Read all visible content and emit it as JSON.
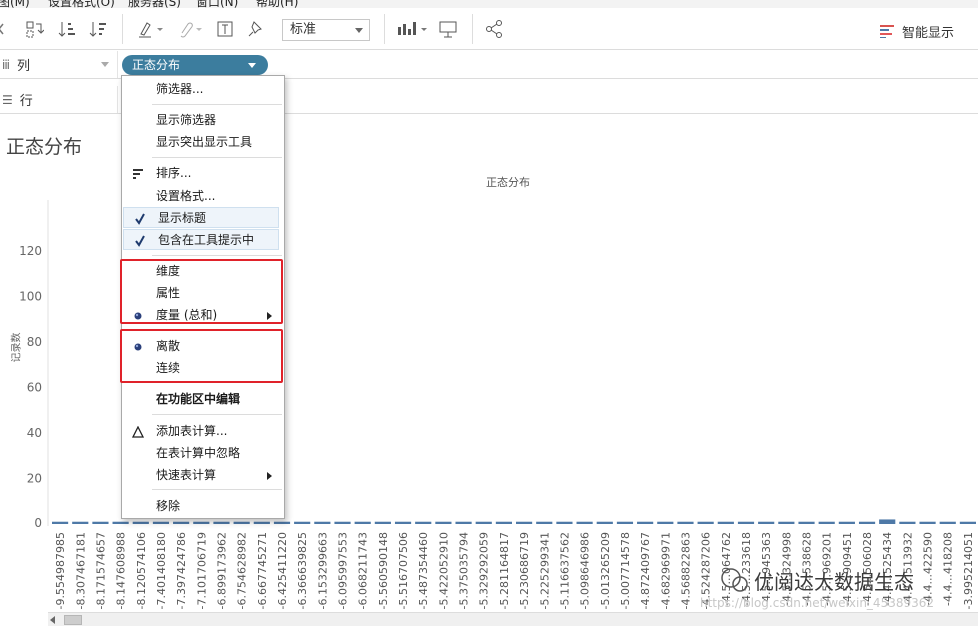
{
  "menubar": [
    "图(M)",
    "设置格式(O)",
    "服务器(S)",
    "窗口(N)",
    "帮助(H)"
  ],
  "toolbar": {
    "mark_size_select": "标准",
    "smart_display": "智能显示"
  },
  "shelves": {
    "columns_label": "列",
    "rows_label": "行",
    "pill_label": "正态分布"
  },
  "view": {
    "title": "正态分布",
    "header": "正态分布",
    "y_axis_title": "记录数"
  },
  "context_menu": {
    "items": [
      {
        "label": "筛选器..."
      },
      {
        "label": "显示筛选器"
      },
      {
        "label": "显示突出显示工具"
      },
      {
        "label": "排序...",
        "icon": "sort-icon"
      },
      {
        "label": "设置格式..."
      },
      {
        "label": "显示标题",
        "checked": true
      },
      {
        "label": "包含在工具提示中",
        "checked": true
      },
      {
        "label": "维度"
      },
      {
        "label": "属性"
      },
      {
        "label": "度量 (总和)",
        "selected": true,
        "submenu": true
      },
      {
        "label": "离散",
        "selected": true
      },
      {
        "label": "连续"
      },
      {
        "label": "在功能区中编辑",
        "bold": true
      },
      {
        "label": "添加表计算...",
        "icon": "delta-icon"
      },
      {
        "label": "在表计算中忽略"
      },
      {
        "label": "快速表计算",
        "submenu": true
      },
      {
        "label": "移除"
      }
    ],
    "highlight_color": "#e0222a"
  },
  "chart_data": {
    "type": "bar",
    "title": "正态分布",
    "ylabel": "记录数",
    "ylim": [
      0,
      130
    ],
    "yticks": [
      0,
      20,
      40,
      60,
      80,
      100,
      120
    ],
    "bar_color": "#4e79a7",
    "categories": [
      "-9.554987985",
      "-8.307467181",
      "-8.171574657",
      "-8.147608988",
      "-8.120574106",
      "-7.401408180",
      "-7.397424786",
      "-7.101706719",
      "-6.899173962",
      "-6.754628982",
      "-6.667745271",
      "-6.425411220",
      "-6.366639825",
      "-6.153299663",
      "-6.095997553",
      "-6.068211743",
      "-5.560590148",
      "-5.516707506",
      "-5.487354460",
      "-5.422052910",
      "-5.375035794",
      "-5.329292059",
      "-5.281164817",
      "-5.230686719",
      "-5.225299341",
      "-5.116637562",
      "-5.098646986",
      "-5.013265209",
      "-5.007714578",
      "-4.872409767",
      "-4.682969971",
      "-4.568822863",
      "-4.524287206",
      "-4.5...064762",
      "-4.5...233618",
      "-4.5...945363",
      "-4.5...324998",
      "-4.5...538628",
      "-4.5...969201",
      "-4.5...909451",
      "-4.5...506028",
      "-4.4...525434",
      "-4.4...513932",
      "-4.4...422590",
      "-4.4...418208",
      "-3.995214051"
    ],
    "values": [
      1,
      1,
      1,
      1,
      1,
      1,
      1,
      1,
      1,
      1,
      1,
      1,
      1,
      1,
      1,
      1,
      1,
      1,
      1,
      1,
      1,
      1,
      1,
      1,
      1,
      1,
      1,
      1,
      1,
      1,
      1,
      1,
      1,
      1,
      1,
      1,
      1,
      1,
      1,
      1,
      1,
      2,
      1,
      1,
      1,
      1
    ]
  },
  "watermark": {
    "text": "优阅达大数据生态",
    "url": "https://blog.csdn.net/weixin_45389362"
  }
}
